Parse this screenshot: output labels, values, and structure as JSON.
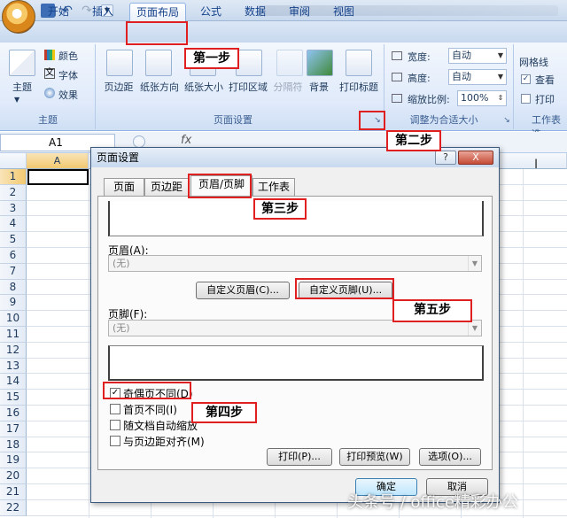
{
  "ribbon_tabs": [
    "开始",
    "插入",
    "页面布局",
    "公式",
    "数据",
    "审阅",
    "视图"
  ],
  "theme_group": {
    "label": "主题",
    "main_button": "主题",
    "items": [
      "颜色",
      "字体",
      "效果"
    ]
  },
  "page_setup_group": {
    "label": "页面设置",
    "buttons": [
      "页边距",
      "纸张方向",
      "纸张大小",
      "打印区域",
      "分隔符",
      "背景",
      "打印标题"
    ]
  },
  "scale_group": {
    "label": "调整为合适大小",
    "width_label": "宽度:",
    "width_value": "自动",
    "height_label": "高度:",
    "height_value": "自动",
    "scale_label": "缩放比例:",
    "scale_value": "100%"
  },
  "sheet_options_group": {
    "label": "工作表选",
    "gridlines_label": "网格线",
    "view_label": "查看",
    "print_label": "打印"
  },
  "formula_bar": {
    "name_box": "A1",
    "fx": "fx"
  },
  "sheet": {
    "col_a": "A",
    "rows": [
      "1",
      "2",
      "3",
      "4",
      "5",
      "6",
      "7",
      "8",
      "9",
      "10",
      "11",
      "12",
      "13",
      "14",
      "15",
      "16",
      "17",
      "18",
      "19",
      "20",
      "21",
      "22"
    ]
  },
  "dialog": {
    "title": "页面设置",
    "help": "?",
    "close": "X",
    "tabs": [
      "页面",
      "页边距",
      "页眉/页脚",
      "工作表"
    ],
    "header_label": "页眉(A):",
    "header_value": "(无)",
    "custom_header_btn": "自定义页眉(C)...",
    "custom_footer_btn": "自定义页脚(U)...",
    "footer_label": "页脚(F):",
    "footer_value": "(无)",
    "checkboxes": [
      {
        "label": "奇偶页不同(D)",
        "checked": true
      },
      {
        "label": "首页不同(I)",
        "checked": false
      },
      {
        "label": "随文档自动缩放",
        "checked": false
      },
      {
        "label": "与页边距对齐(M)",
        "checked": false
      }
    ],
    "print_btn": "打印(P)...",
    "preview_btn": "打印预览(W)",
    "options_btn": "选项(O)...",
    "ok_btn": "确定",
    "cancel_btn": "取消"
  },
  "annotations": {
    "step1": "第一步",
    "step2": "第二步",
    "step3": "第三步",
    "step4": "第四步",
    "step5": "第五步"
  },
  "watermark": "头条号 / office精彩办公",
  "colors": {
    "annotation_red": "#e02020",
    "ribbon_blue": "#dfeafa",
    "tab_text": "#15428b"
  }
}
